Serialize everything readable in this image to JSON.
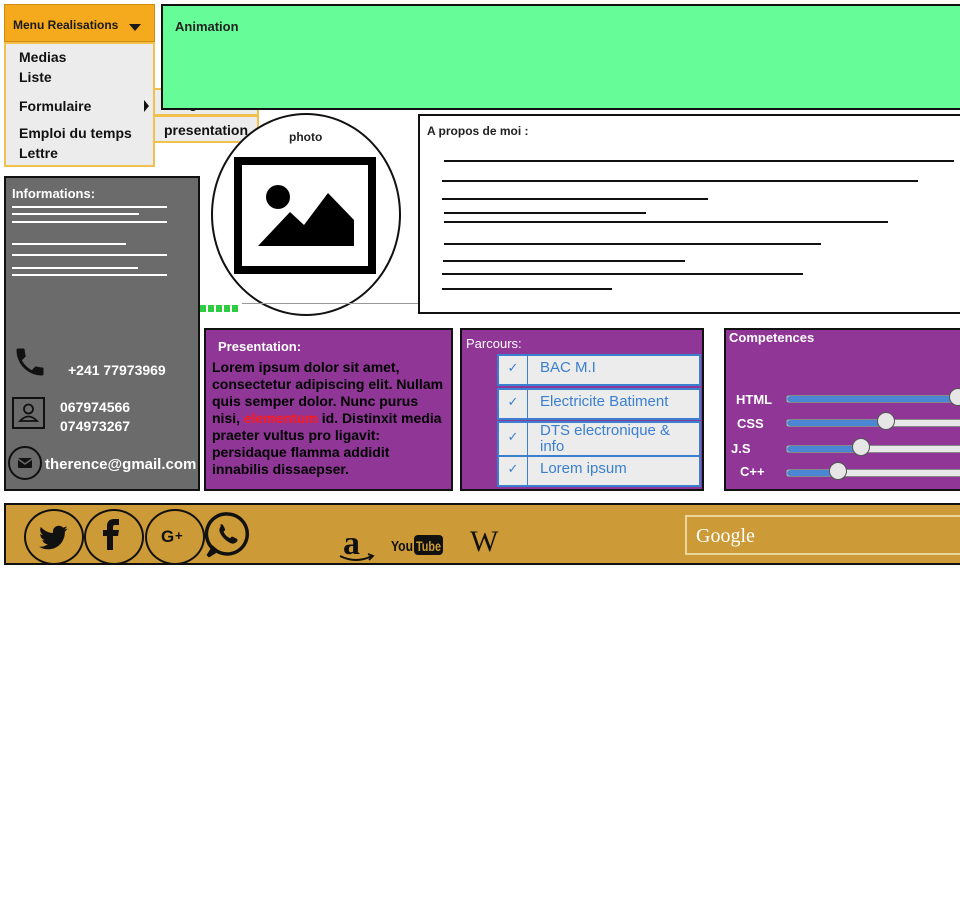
{
  "menu": {
    "button_label": "Menu Realisations",
    "items": [
      "Medias",
      "Liste",
      "Formulaire",
      "Emploi du temps",
      "Lettre"
    ],
    "submenu": [
      "Integration",
      "presentation"
    ]
  },
  "animation": {
    "label": "Animation"
  },
  "photo": {
    "label": "photo"
  },
  "about": {
    "title": "A propos de moi :"
  },
  "informations": {
    "title": "Informations:",
    "phone": "+241 77973969",
    "numbers": [
      "067974566",
      "074973267"
    ],
    "email": "therence@gmail.com"
  },
  "presentation": {
    "title": "Presentation:",
    "text_before": "Lorem ipsum dolor sit amet, consectetur adipiscing elit. Nullam quis semper dolor. Nunc purus nisi, ",
    "text_highlight": "elementum",
    "text_after": " id. Distinxit  media praeter vultus pro ligavit: persidaque flamma addidit innabilis dissaepser."
  },
  "parcours": {
    "title": "Parcours:",
    "items": [
      "BAC M.I",
      "Electricite Batiment",
      "DTS electronique & info",
      "Lorem ipsum"
    ]
  },
  "competences": {
    "title": "Competences",
    "skills": [
      {
        "name": "HTML",
        "level": 0.9
      },
      {
        "name": "CSS",
        "level": 0.52
      },
      {
        "name": "J.S",
        "level": 0.39
      },
      {
        "name": "C++",
        "level": 0.27
      }
    ]
  },
  "footer": {
    "social_icons": [
      "twitter-icon",
      "facebook-icon",
      "google-plus-icon",
      "whatsapp-icon"
    ],
    "brands": [
      "amazon-logo",
      "youtube-logo",
      "wikipedia-logo"
    ],
    "youtube_text": "YouTube",
    "wiki_text": "W",
    "search_placeholder": "Google"
  },
  "colors": {
    "menu_orange": "#f5a91c",
    "animation_green": "#66fd98",
    "panel_purple": "#8f3696",
    "info_gray": "#6b6b6b",
    "footer_gold": "#cc9a36",
    "accent_blue": "#3a7fd0"
  }
}
